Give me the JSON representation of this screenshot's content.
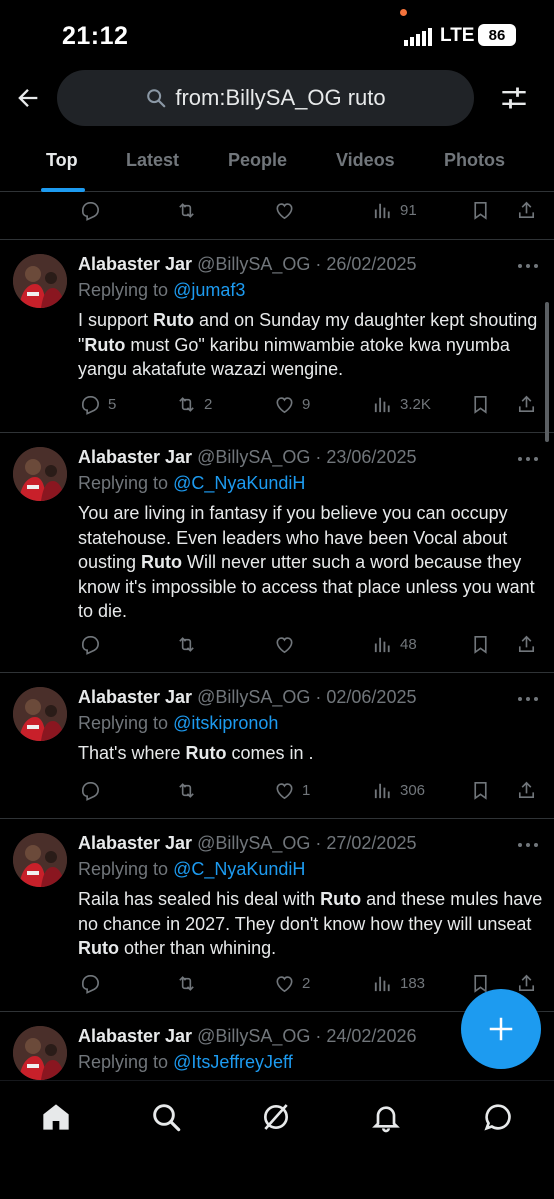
{
  "status_bar": {
    "time": "21:12",
    "network": "LTE",
    "battery": "86"
  },
  "search": {
    "query": "from:BillySA_OG ruto"
  },
  "tabs": [
    {
      "label": "Top",
      "active": true
    },
    {
      "label": "Latest",
      "active": false
    },
    {
      "label": "People",
      "active": false
    },
    {
      "label": "Videos",
      "active": false
    },
    {
      "label": "Photos",
      "active": false
    }
  ],
  "top_partial_tweet": {
    "views": "91"
  },
  "tweets": [
    {
      "name": "Alabaster Jar",
      "meta": "@BillySA_OG · 26/02/2025",
      "replying_prefix": "Replying to ",
      "replying_to": "@jumaf3",
      "text_parts": [
        {
          "t": "I support ",
          "b": false
        },
        {
          "t": "Ruto",
          "b": true
        },
        {
          "t": " and on Sunday my daughter kept shouting \"",
          "b": false
        },
        {
          "t": "Ruto",
          "b": true
        },
        {
          "t": " must Go\" karibu nimwambie atoke kwa nyumba yangu akatafute wazazi wengine.",
          "b": false
        }
      ],
      "replies": "5",
      "reposts": "2",
      "likes": "9",
      "views": "3.2K"
    },
    {
      "name": "Alabaster Jar",
      "meta": "@BillySA_OG · 23/06/2025",
      "replying_prefix": "Replying to ",
      "replying_to": "@C_NyaKundiH",
      "text_parts": [
        {
          "t": "You are living in fantasy if you believe you can occupy statehouse. Even leaders who have been Vocal about ousting ",
          "b": false
        },
        {
          "t": "Ruto",
          "b": true
        },
        {
          "t": " Will never utter such a word because they know it's impossible to access that place unless you want to die.",
          "b": false
        }
      ],
      "replies": "",
      "reposts": "",
      "likes": "",
      "views": "48"
    },
    {
      "name": "Alabaster Jar",
      "meta": "@BillySA_OG · 02/06/2025",
      "replying_prefix": "Replying to ",
      "replying_to": "@itskipronoh",
      "text_parts": [
        {
          "t": "That's where ",
          "b": false
        },
        {
          "t": "Ruto",
          "b": true
        },
        {
          "t": " comes in .",
          "b": false
        }
      ],
      "replies": "",
      "reposts": "",
      "likes": "1",
      "views": "306"
    },
    {
      "name": "Alabaster Jar",
      "meta": "@BillySA_OG · 27/02/2025",
      "replying_prefix": "Replying to ",
      "replying_to": "@C_NyaKundiH",
      "text_parts": [
        {
          "t": "Raila has sealed his deal with ",
          "b": false
        },
        {
          "t": "Ruto",
          "b": true
        },
        {
          "t": " and these mules have no chance in 2027. They don't know how they will unseat ",
          "b": false
        },
        {
          "t": "Ruto",
          "b": true
        },
        {
          "t": " other than whining.",
          "b": false
        }
      ],
      "replies": "",
      "reposts": "",
      "likes": "2",
      "views": "183"
    },
    {
      "name": "Alabaster Jar",
      "meta": "@BillySA_OG · 24/02/2026",
      "replying_prefix": "Replying to ",
      "replying_to": "@ItsJeffreyJeff",
      "text_parts": [],
      "replies": "",
      "reposts": "",
      "likes": "",
      "views": ""
    }
  ],
  "icons": {
    "back": "arrow-left-icon",
    "search": "search-icon",
    "filter": "filter-sliders-icon",
    "compose": "plus-icon",
    "nav": [
      "home-icon",
      "search-icon",
      "grok-icon",
      "bell-icon",
      "chat-icon"
    ]
  },
  "colors": {
    "accent": "#1d9bf0",
    "background": "#000000",
    "muted": "#71767b",
    "text": "#e7e9ea"
  }
}
